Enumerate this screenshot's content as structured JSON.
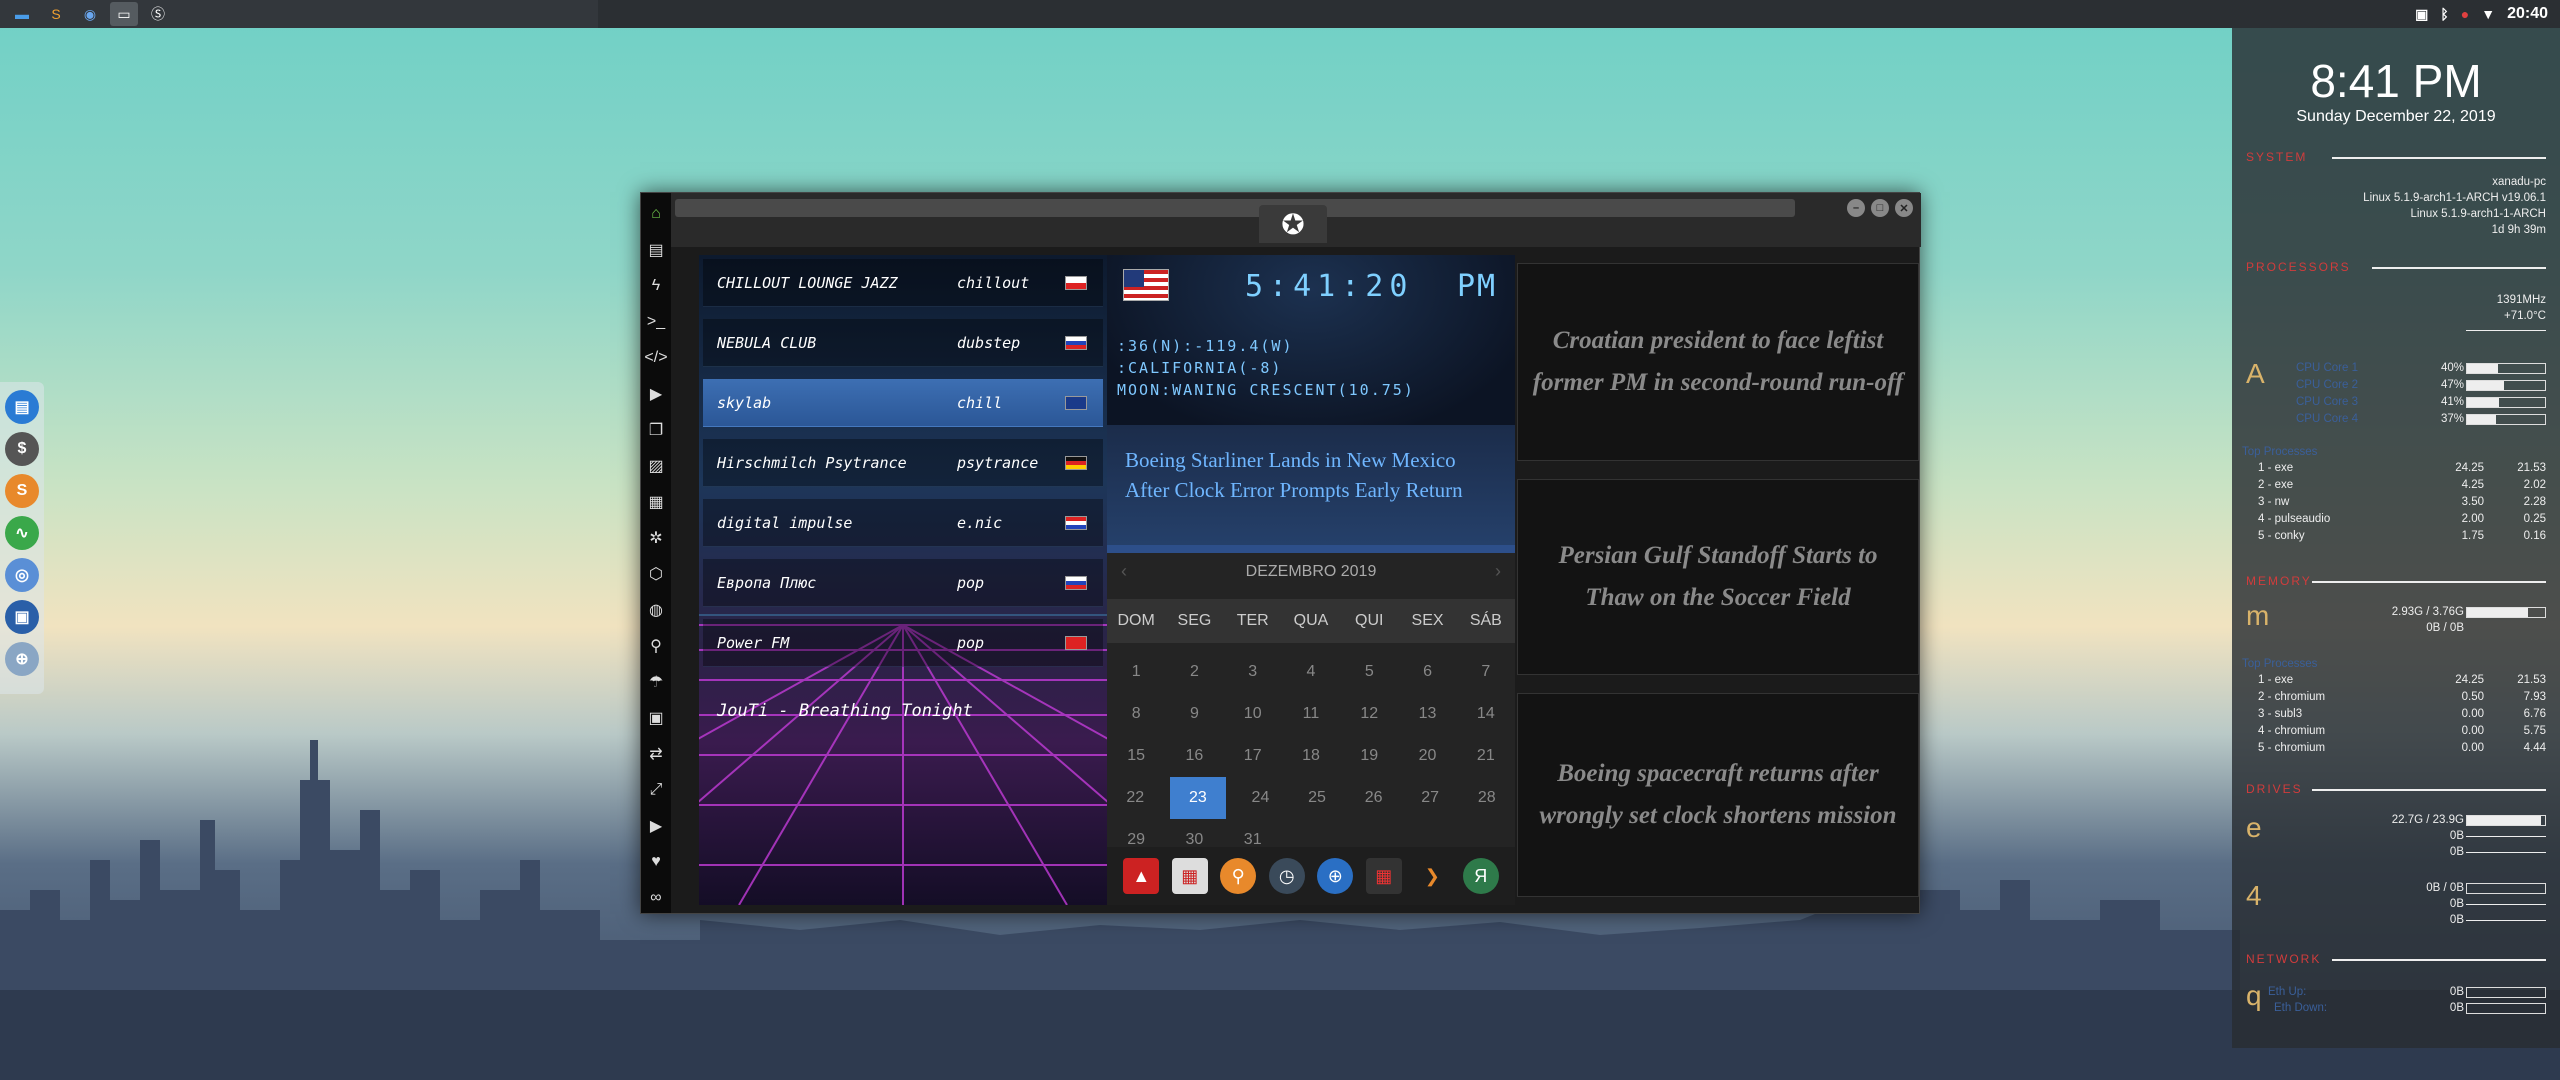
{
  "top_panel": {
    "icons": [
      "files-icon",
      "sublime-icon",
      "chrome-icon",
      "desktop-icon",
      "script-icon"
    ],
    "clock": "20:40"
  },
  "dock": {
    "icons": [
      "window-icon",
      "money-icon",
      "s-icon",
      "pulse-icon",
      "chrome-icon",
      "screen-icon",
      "globe-icon"
    ],
    "labels": [
      "$",
      "S"
    ]
  },
  "radio": {
    "stations": [
      {
        "name": "CHILLOUT LOUNGE JAZZ",
        "genre": "chillout"
      },
      {
        "name": "NEBULA CLUB",
        "genre": "dubstep"
      },
      {
        "name": "skylab",
        "genre": "chill"
      },
      {
        "name": "Hirschmilch Psytrance",
        "genre": "psytrance"
      },
      {
        "name": "digital impulse",
        "genre": "e.nic"
      },
      {
        "name": "Европа Плюс",
        "genre": "pop"
      },
      {
        "name": "Power FM",
        "genre": "pop"
      }
    ],
    "now_playing": "JouTi - Breathing Tonight"
  },
  "clock_panel": {
    "time": "5:41:20",
    "ampm": "PM",
    "coords": ":36(N):-119.4(W)",
    "location": ":CALIFORNIA(-8)",
    "moon": "MOON:WANING CRESCENT(10.75)"
  },
  "headline": "Boeing Starliner Lands in New Mexico After Clock Error Prompts Early Return",
  "calendar": {
    "month": "DEZEMBRO 2019",
    "days": [
      "DOM",
      "SEG",
      "TER",
      "QUA",
      "QUI",
      "SEX",
      "SÁB"
    ],
    "weeks": [
      [
        "1",
        "2",
        "3",
        "4",
        "5",
        "6",
        "7"
      ],
      [
        "8",
        "9",
        "10",
        "11",
        "12",
        "13",
        "14"
      ],
      [
        "15",
        "16",
        "17",
        "18",
        "19",
        "20",
        "21"
      ],
      [
        "22",
        "23",
        "24",
        "25",
        "26",
        "27",
        "28"
      ],
      [
        "29",
        "30",
        "31",
        "",
        "",
        "",
        ""
      ]
    ],
    "today": "23",
    "prev": "‹",
    "next": "›"
  },
  "news": [
    "Croatian president to face leftist former PM in second-round run-off",
    "Persian Gulf Standoff Starts to Thaw on the Soccer Field",
    "Boeing spacecraft returns after wrongly set clock shortens mission"
  ],
  "conky": {
    "time": "8:41 PM",
    "date": "Sunday December 22, 2019",
    "system": {
      "title": "SYSTEM",
      "hostname": "xanadu-pc",
      "os": "Linux 5.1.9-arch1-1-ARCH v19.06.1",
      "kernel": "Linux 5.1.9-arch1-1-ARCH",
      "uptime": "1d 9h 39m"
    },
    "processors": {
      "title": "PROCESSORS",
      "freq": "1391MHz",
      "temp": "+71.0°C",
      "letter": "A",
      "cores": [
        {
          "label": "CPU Core 1",
          "pct": "40%",
          "fill": 0.4
        },
        {
          "label": "CPU Core 2",
          "pct": "47%",
          "fill": 0.47
        },
        {
          "label": "CPU Core 3",
          "pct": "41%",
          "fill": 0.41
        },
        {
          "label": "CPU Core 4",
          "pct": "37%",
          "fill": 0.37
        }
      ],
      "top_header": "Top Processes",
      "procs": [
        {
          "name": "1 - exe",
          "cpu": "24.25",
          "mem": "21.53"
        },
        {
          "name": "2 - exe",
          "cpu": "4.25",
          "mem": "2.02"
        },
        {
          "name": "3 - nw",
          "cpu": "3.50",
          "mem": "2.28"
        },
        {
          "name": "4 - pulseaudio",
          "cpu": "2.00",
          "mem": "0.25"
        },
        {
          "name": "5 - conky",
          "cpu": "1.75",
          "mem": "0.16"
        }
      ]
    },
    "memory": {
      "title": "MEMORY",
      "letter": "m",
      "ram": "2.93G / 3.76G",
      "ram_fill": 0.78,
      "swap": "0B / 0B",
      "top_header": "Top Processes",
      "procs": [
        {
          "name": "1 - exe",
          "cpu": "24.25",
          "mem": "21.53"
        },
        {
          "name": "2 - chromium",
          "cpu": "0.50",
          "mem": "7.93"
        },
        {
          "name": "3 - subl3",
          "cpu": "0.00",
          "mem": "6.76"
        },
        {
          "name": "4 - chromium",
          "cpu": "0.00",
          "mem": "5.75"
        },
        {
          "name": "5 - chromium",
          "cpu": "0.00",
          "mem": "4.44"
        }
      ]
    },
    "drives": {
      "title": "DRIVES",
      "letter1": "e",
      "root": "22.7G / 23.9G",
      "root_fill": 0.95,
      "io_read": "0B",
      "io_write": "0B",
      "letter2": "4",
      "d2": "0B / 0B",
      "d2_read": "0B",
      "d2_write": "0B"
    },
    "network": {
      "title": "NETWORK",
      "letter": "q",
      "eth_up_label": "Eth Up:",
      "eth_up": "0B",
      "eth_down_label": "Eth Down:",
      "eth_down": "0B"
    }
  }
}
